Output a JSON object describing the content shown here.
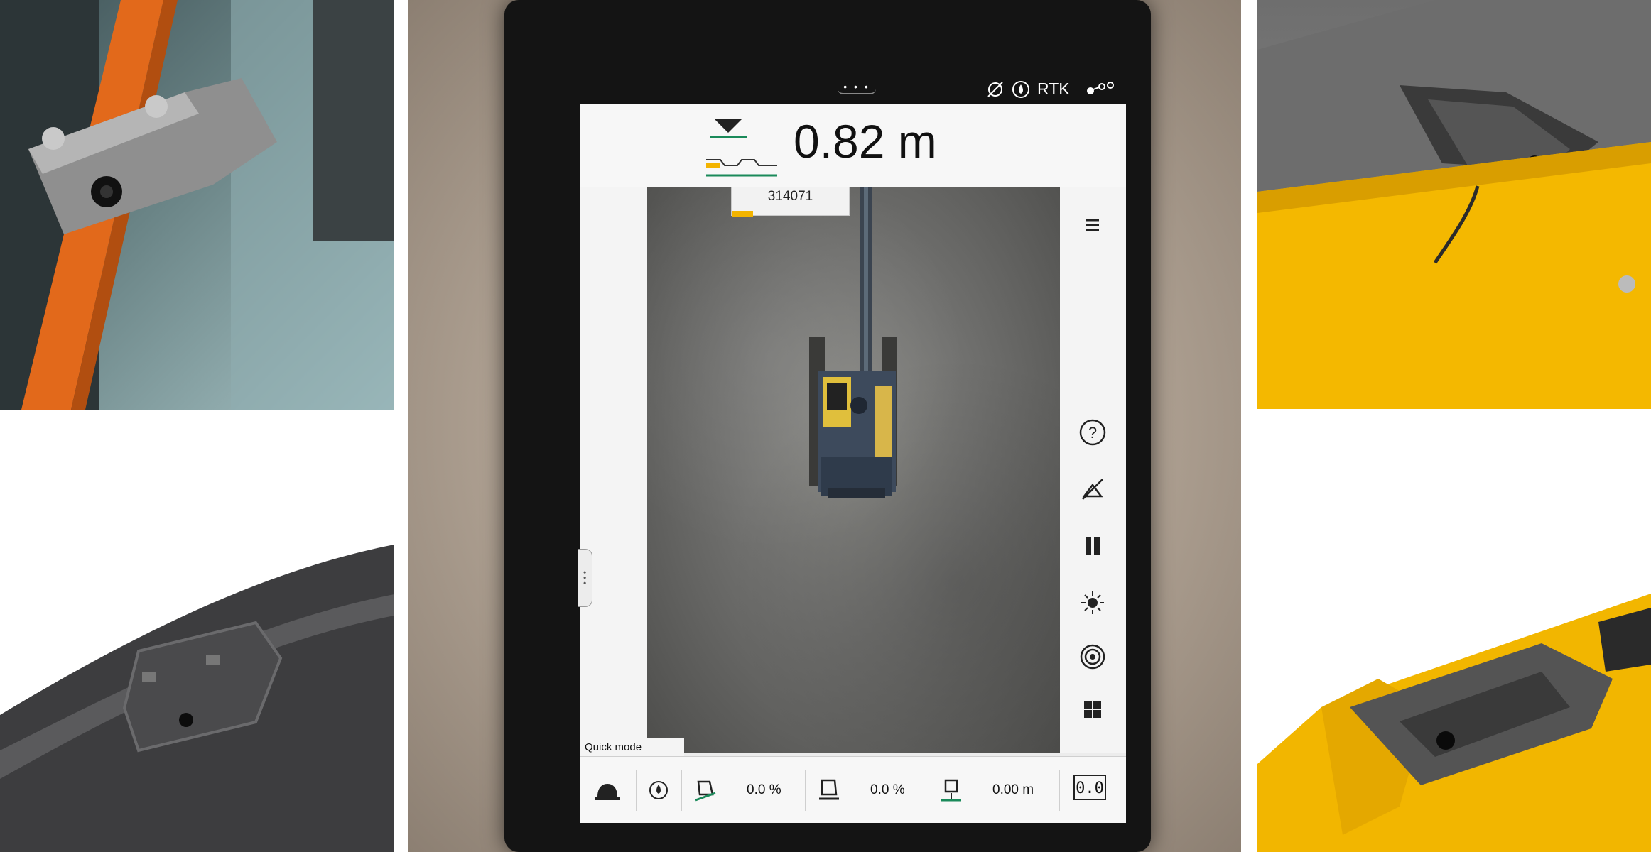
{
  "status_bar": {
    "handle_dots": "• • •",
    "rtk_label": "RTK",
    "icons": [
      "satellite-off-icon",
      "gnss-drop-icon",
      "rtk-label",
      "connection-icon"
    ]
  },
  "header": {
    "depth_value": "0.82 m",
    "icons": [
      "target-height-icon",
      "profile-line-icon"
    ]
  },
  "camera": {
    "machine_id": "314071"
  },
  "toolbar": {
    "items": [
      "menu-icon",
      "help-icon",
      "satellite-off-icon",
      "pause-icon",
      "laser-icon",
      "target-icon",
      "grid-icon"
    ]
  },
  "bottom_bar": {
    "mode_label": "Quick mode",
    "slope_1": "0.0 %",
    "slope_2": "0.0 %",
    "height_offset": "0.00 m",
    "reset_label": "0.0"
  },
  "colors": {
    "accent": "#f3b400",
    "status_bar_bg": "#141414",
    "screen_bg": "#ececec",
    "target_line": "#1a8a5a"
  }
}
